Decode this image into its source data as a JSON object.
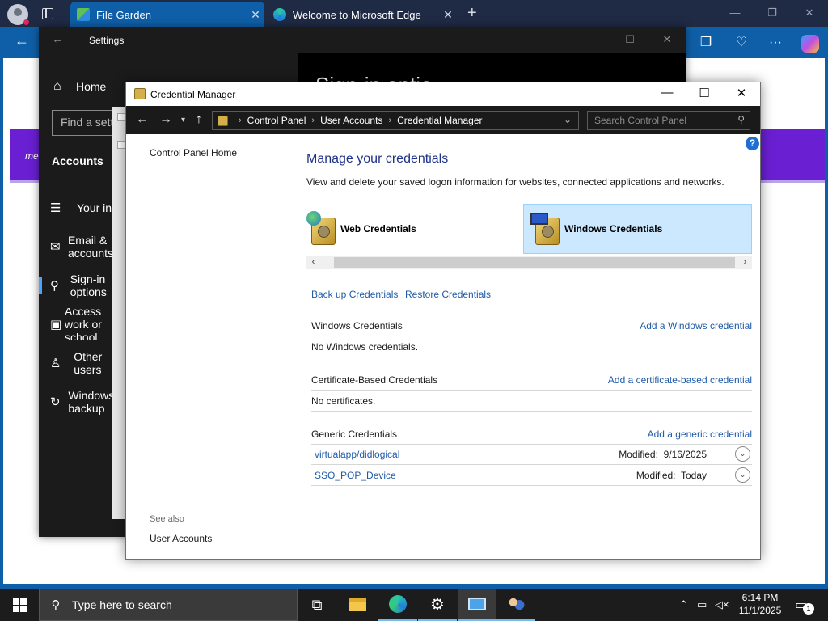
{
  "edge": {
    "tabs": [
      {
        "title": "File Garden",
        "close": "✕"
      },
      {
        "title": "Welcome to Microsoft Edge",
        "close": "✕"
      }
    ],
    "new_tab": "+",
    "back": "←",
    "minimize": "—",
    "restore": "❐",
    "close": "✕",
    "toolbar_icons": [
      "tab-actions-icon",
      "extensions-icon",
      "more-icon",
      "copilot-icon"
    ],
    "more": "···",
    "banner_text": "me"
  },
  "settings": {
    "title": "Settings",
    "back": "←",
    "minimize": "—",
    "maximize": "☐",
    "close": "✕",
    "heading": "Sign-in optio",
    "home_label": "Home",
    "search_placeholder": "Find a sett",
    "section": "Accounts",
    "nav": [
      {
        "label": "Your info",
        "icon": "person-card-icon"
      },
      {
        "label": "Email & accounts",
        "icon": "mail-icon"
      },
      {
        "label": "Sign-in options",
        "icon": "key-icon",
        "selected": true
      },
      {
        "label": "Access work or school",
        "icon": "briefcase-icon"
      },
      {
        "label": "Other users",
        "icon": "add-user-icon"
      },
      {
        "label": "Windows backup",
        "icon": "sync-icon"
      }
    ]
  },
  "cm": {
    "window_title": "Credential Manager",
    "minimize": "—",
    "maximize": "☐",
    "close": "✕",
    "breadcrumb": [
      "Control Panel",
      "User Accounts",
      "Credential Manager"
    ],
    "search_placeholder": "Search Control Panel",
    "left_link": "Control Panel Home",
    "see_also": "See also",
    "see_also_link": "User Accounts",
    "help": "?",
    "heading": "Manage your credentials",
    "description": "View and delete your saved logon information for websites, connected applications and networks.",
    "web_credentials": "Web Credentials",
    "windows_credentials": "Windows Credentials",
    "backup_link": "Back up Credentials",
    "restore_link": "Restore Credentials",
    "sections": {
      "windows": {
        "title": "Windows Credentials",
        "add": "Add a Windows credential",
        "empty": "No Windows credentials."
      },
      "certificate": {
        "title": "Certificate-Based Credentials",
        "add": "Add a certificate-based credential",
        "empty": "No certificates."
      },
      "generic": {
        "title": "Generic Credentials",
        "add": "Add a generic credential"
      }
    },
    "generic_items": [
      {
        "name": "virtualapp/didlogical",
        "modified": "Modified:  9/16/2025"
      },
      {
        "name": "SSO_POP_Device",
        "modified": "Modified:  Today"
      }
    ]
  },
  "taskbar": {
    "search_placeholder": "Type here to search",
    "time": "6:14 PM",
    "date": "11/1/2025",
    "notification_count": "1",
    "apps": [
      "task-view-icon",
      "file-explorer-icon",
      "edge-icon",
      "settings-icon",
      "control-panel-icon",
      "user-accounts-icon"
    ]
  }
}
